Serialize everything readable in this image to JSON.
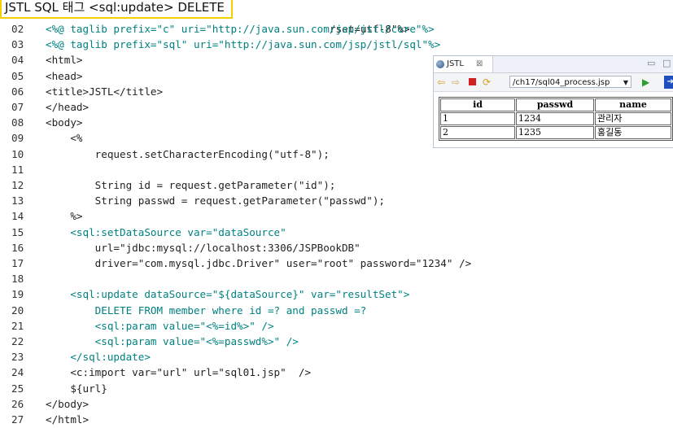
{
  "slide": {
    "title": "JSTL SQL 태그 <sql:update> DELETE"
  },
  "code": {
    "first_line_tail": "rset=utf-8\"%>",
    "lines": [
      {
        "n": "02",
        "text": "<%@ taglib prefix=\"c\" uri=\"http://java.sun.com/jsp/jstl/core\"%>"
      },
      {
        "n": "03",
        "text": "<%@ taglib prefix=\"sql\" uri=\"http://java.sun.com/jsp/jstl/sql\"%>"
      },
      {
        "n": "04",
        "text": "<html>"
      },
      {
        "n": "05",
        "text": "<head>"
      },
      {
        "n": "06",
        "text": "<title>JSTL</title>"
      },
      {
        "n": "07",
        "text": "</head>"
      },
      {
        "n": "08",
        "text": "<body>"
      },
      {
        "n": "09",
        "text": "    <%"
      },
      {
        "n": "10",
        "text": "        request.setCharacterEncoding(\"utf-8\");"
      },
      {
        "n": "11",
        "text": ""
      },
      {
        "n": "12",
        "text": "        String id = request.getParameter(\"id\");"
      },
      {
        "n": "13",
        "text": "        String passwd = request.getParameter(\"passwd\");"
      },
      {
        "n": "14",
        "text": "    %>"
      },
      {
        "n": "15",
        "text": "    <sql:setDataSource var=\"dataSource\""
      },
      {
        "n": "16",
        "text": "        url=\"jdbc:mysql://localhost:3306/JSPBookDB\""
      },
      {
        "n": "17",
        "text": "        driver=\"com.mysql.jdbc.Driver\" user=\"root\" password=\"1234\" />"
      },
      {
        "n": "18",
        "text": ""
      },
      {
        "n": "19",
        "text": "    <sql:update dataSource=\"${dataSource}\" var=\"resultSet\">"
      },
      {
        "n": "20",
        "text": "        DELETE FROM member where id =? and passwd =?"
      },
      {
        "n": "21",
        "text": "        <sql:param value=\"<%=id%>\" />"
      },
      {
        "n": "22",
        "text": "        <sql:param value=\"<%=passwd%>\" />"
      },
      {
        "n": "23",
        "text": "    </sql:update>"
      },
      {
        "n": "24",
        "text": "    <c:import var=\"url\" url=\"sql01.jsp\"  />"
      },
      {
        "n": "25",
        "text": "    ${url}"
      },
      {
        "n": "26",
        "text": "</body>"
      },
      {
        "n": "27",
        "text": "</html>"
      }
    ]
  },
  "browser": {
    "tab_label": "JSTL",
    "tab_close": "⊠",
    "url": "/ch17/sql04_process.jsp",
    "table": {
      "headers": [
        "id",
        "passwd",
        "name"
      ],
      "rows": [
        [
          "1",
          "1234",
          "관리자"
        ],
        [
          "2",
          "1235",
          "홍길동"
        ]
      ]
    }
  }
}
